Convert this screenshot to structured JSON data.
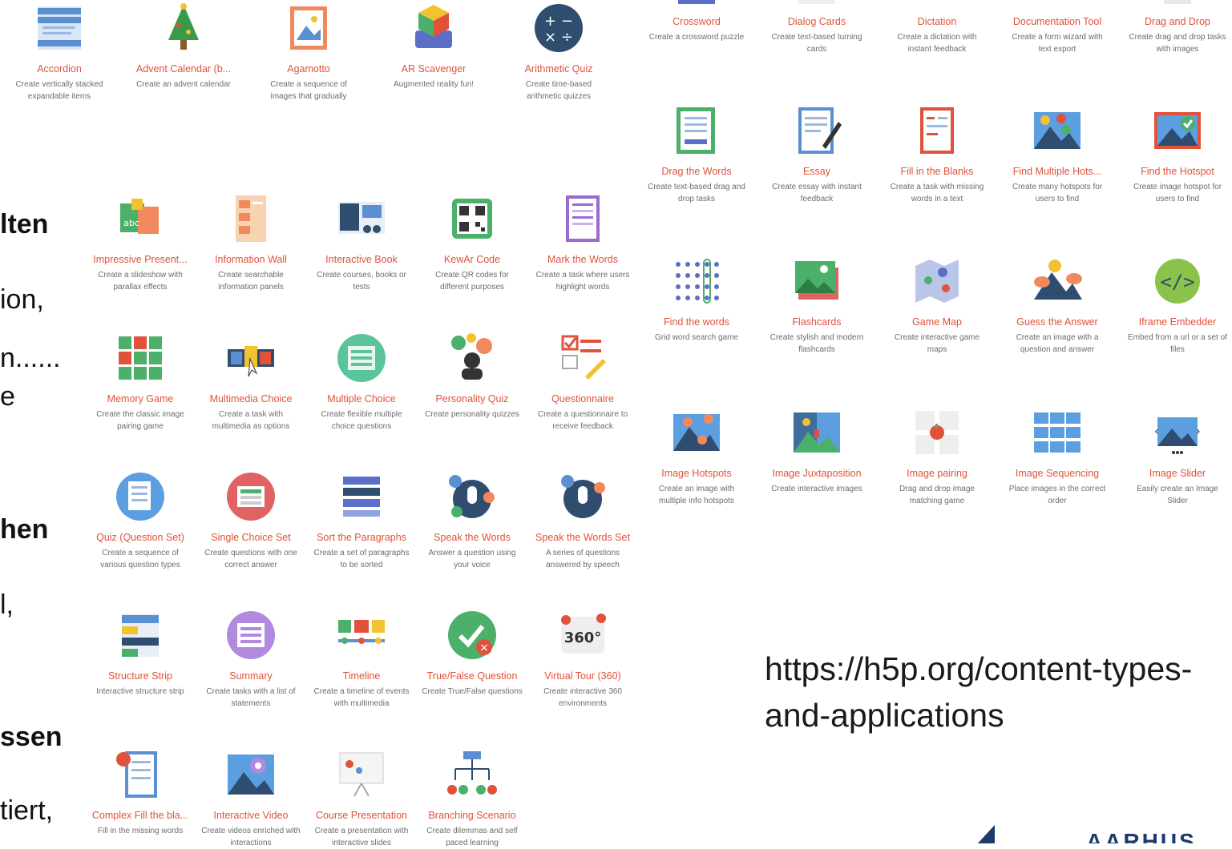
{
  "colors": {
    "title": "#e0523a",
    "desc": "#6c6c6c",
    "brand": "#1d3a6c"
  },
  "slide_fragments": [
    {
      "text": "lten",
      "bold": true
    },
    {
      "text": "ion,",
      "bold": false
    },
    {
      "text": "n......",
      "bold": false
    },
    {
      "text": "e",
      "bold": false
    },
    {
      "text": "hen",
      "bold": true
    },
    {
      "text": "l,",
      "bold": false
    },
    {
      "text": "ssen",
      "bold": true
    },
    {
      "text": "tiert,",
      "bold": false
    }
  ],
  "url_text": "https://h5p.org/content-types-and-applications",
  "logo_text": "AARHUS",
  "cards": [
    {
      "title": "Accordion",
      "desc": "Create vertically stacked expandable items",
      "icon": "accordion-icon"
    },
    {
      "title": "Advent Calendar (b...",
      "desc": "Create an advent calendar",
      "icon": "christmas-tree-icon"
    },
    {
      "title": "Agamotto",
      "desc": "Create a sequence of images that gradually",
      "icon": "image-frame-icon"
    },
    {
      "title": "AR Scavenger",
      "desc": "Augmented reality fun!",
      "icon": "ar-cube-icon"
    },
    {
      "title": "Arithmetic Quiz",
      "desc": "Create time-based arithmetic quizzes",
      "icon": "arithmetic-icon"
    },
    {
      "title": "Impressive Present...",
      "desc": "Create a slideshow with parallax effects",
      "icon": "presentation-icon"
    },
    {
      "title": "Information Wall",
      "desc": "Create searchable information panels",
      "icon": "info-wall-icon"
    },
    {
      "title": "Interactive Book",
      "desc": "Create courses, books or tests",
      "icon": "book-icon"
    },
    {
      "title": "KewAr Code",
      "desc": "Create QR codes for different purposes",
      "icon": "qr-code-icon"
    },
    {
      "title": "Mark the Words",
      "desc": "Create a task where users highlight words",
      "icon": "mark-words-icon"
    },
    {
      "title": "Memory Game",
      "desc": "Create the classic image pairing game",
      "icon": "memory-grid-icon"
    },
    {
      "title": "Multimedia Choice",
      "desc": "Create a task with multimedia as options",
      "icon": "multimedia-choice-icon"
    },
    {
      "title": "Multiple Choice",
      "desc": "Create flexible multiple choice questions",
      "icon": "multiple-choice-icon"
    },
    {
      "title": "Personality Quiz",
      "desc": "Create personality quizzes",
      "icon": "personality-icon"
    },
    {
      "title": "Questionnaire",
      "desc": "Create a questionnaire to receive feedback",
      "icon": "questionnaire-icon"
    },
    {
      "title": "Quiz (Question Set)",
      "desc": "Create a sequence of various question types",
      "icon": "question-set-icon"
    },
    {
      "title": "Single Choice Set",
      "desc": "Create questions with one correct answer",
      "icon": "single-choice-icon"
    },
    {
      "title": "Sort the Paragraphs",
      "desc": "Create a set of paragraphs to be sorted",
      "icon": "sort-paragraphs-icon"
    },
    {
      "title": "Speak the Words",
      "desc": "Answer a question using your voice",
      "icon": "microphone-icon"
    },
    {
      "title": "Speak the Words Set",
      "desc": "A series of questions answered by speech",
      "icon": "microphone-set-icon"
    },
    {
      "title": "Structure Strip",
      "desc": "Interactive structure strip",
      "icon": "structure-strip-icon"
    },
    {
      "title": "Summary",
      "desc": "Create tasks with a list of statements",
      "icon": "summary-icon"
    },
    {
      "title": "Timeline",
      "desc": "Create a timeline of events with multimedia",
      "icon": "timeline-icon"
    },
    {
      "title": "True/False Question",
      "desc": "Create True/False questions",
      "icon": "true-false-icon"
    },
    {
      "title": "Virtual Tour (360)",
      "desc": "Create interactive 360 environments",
      "icon": "tour-360-icon"
    },
    {
      "title": "Complex Fill the bla...",
      "desc": "Fill in the missing words",
      "icon": "complex-fill-icon"
    },
    {
      "title": "Interactive Video",
      "desc": "Create videos enriched with interactions",
      "icon": "video-icon"
    },
    {
      "title": "Course Presentation",
      "desc": "Create a presentation with interactive slides",
      "icon": "course-presentation-icon"
    },
    {
      "title": "Branching Scenario",
      "desc": "Create dilemmas and self paced learning",
      "icon": "branching-icon"
    },
    {
      "title": "Crossword",
      "desc": "Create a crossword puzzle",
      "icon": "crossword-icon"
    },
    {
      "title": "Dialog Cards",
      "desc": "Create text-based turning cards",
      "icon": "dialog-cards-icon"
    },
    {
      "title": "Dictation",
      "desc": "Create a dictation with instant feedback",
      "icon": "dictation-icon"
    },
    {
      "title": "Documentation Tool",
      "desc": "Create a form wizard with text export",
      "icon": "documentation-icon"
    },
    {
      "title": "Drag and Drop",
      "desc": "Create drag and drop tasks with images",
      "icon": "drag-drop-icon"
    },
    {
      "title": "Drag the Words",
      "desc": "Create text-based drag and drop tasks",
      "icon": "drag-words-icon"
    },
    {
      "title": "Essay",
      "desc": "Create essay with instant feedback",
      "icon": "essay-icon"
    },
    {
      "title": "Fill in the Blanks",
      "desc": "Create a task with missing words in a text",
      "icon": "fill-blanks-icon"
    },
    {
      "title": "Find Multiple Hots...",
      "desc": "Create many hotspots for users to find",
      "icon": "multi-hotspot-icon"
    },
    {
      "title": "Find the Hotspot",
      "desc": "Create image hotspot for users to find",
      "icon": "hotspot-icon"
    },
    {
      "title": "Find the words",
      "desc": "Grid word search game",
      "icon": "word-search-icon"
    },
    {
      "title": "Flashcards",
      "desc": "Create stylish and modern flashcards",
      "icon": "flashcards-icon"
    },
    {
      "title": "Game Map",
      "desc": "Create interactive game maps",
      "icon": "game-map-icon"
    },
    {
      "title": "Guess the Answer",
      "desc": "Create an image with a question and answer",
      "icon": "guess-answer-icon"
    },
    {
      "title": "Iframe Embedder",
      "desc": "Embed from a url or a set of files",
      "icon": "code-icon"
    },
    {
      "title": "Image Hotspots",
      "desc": "Create an image with multiple info hotspots",
      "icon": "image-hotspots-icon"
    },
    {
      "title": "Image Juxtaposition",
      "desc": "Create interactive images",
      "icon": "juxtaposition-icon"
    },
    {
      "title": "Image pairing",
      "desc": "Drag and drop image matching game",
      "icon": "image-pairing-icon"
    },
    {
      "title": "Image Sequencing",
      "desc": "Place images in the correct order",
      "icon": "image-sequencing-icon"
    },
    {
      "title": "Image Slider",
      "desc": "Easily create an Image Slider",
      "icon": "image-slider-icon"
    }
  ]
}
